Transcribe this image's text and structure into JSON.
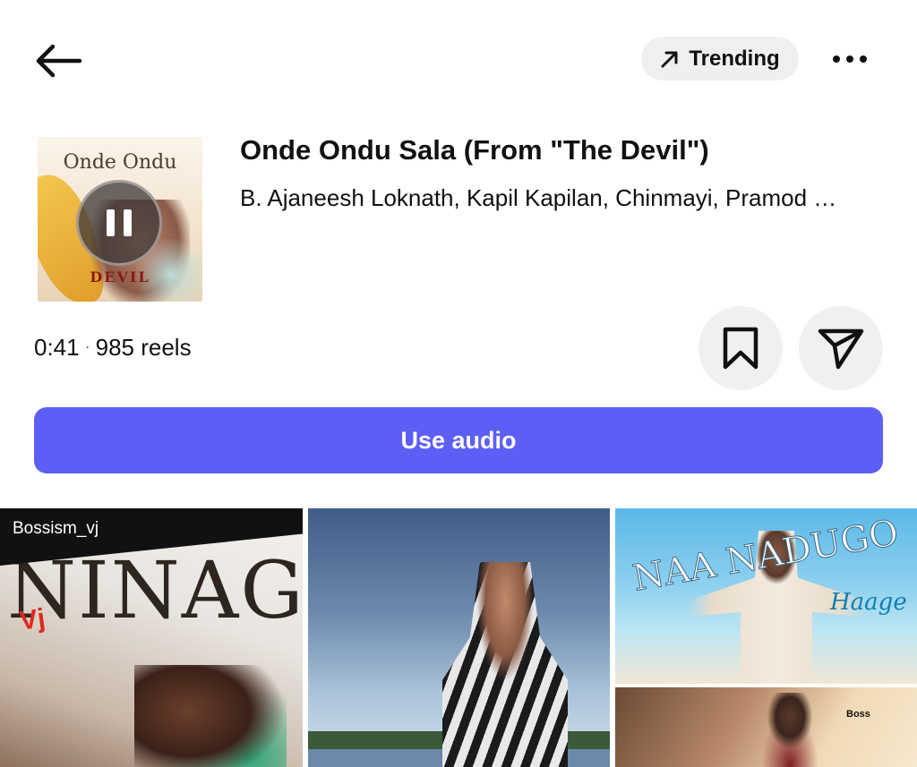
{
  "header": {
    "trending_label": "Trending"
  },
  "track": {
    "cover_title": "Onde Ondu",
    "cover_logo": "DEVIL",
    "title": "Onde Ondu Sala (From \"The Devil\")",
    "artists": "B. Ajaneesh Loknath, Kapil Kapilan, Chinmayi, Pramod …",
    "duration": "0:41",
    "reels_count": "985 reels"
  },
  "actions": {
    "use_audio_label": "Use audio"
  },
  "reels": [
    {
      "username": "Bossism_vj",
      "overlay_text": "NINAG",
      "tag": "Vj"
    },
    {},
    {
      "overlay_text": "NAA NADUGO",
      "subtitle": "Haage"
    },
    {
      "tag": "Boss"
    }
  ],
  "colors": {
    "accent": "#5d5ef6",
    "pill_bg": "#efefef",
    "circle_btn_bg": "#f0f0f0"
  }
}
